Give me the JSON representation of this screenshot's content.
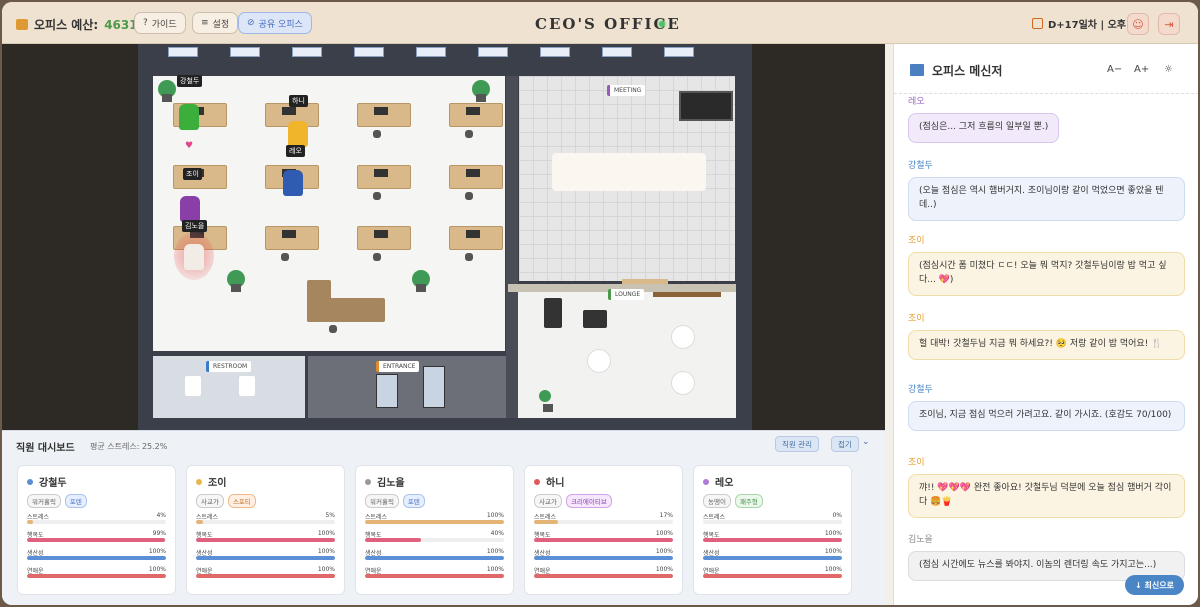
{
  "header": {
    "budget_label": "오피스 예산:",
    "budget_value": "4631원",
    "guide": "가이드",
    "settings": "설정",
    "share": "공유 오피스",
    "title": "CEO'S OFFICE",
    "day": "D+17일차 | 오후"
  },
  "game": {
    "rooms": {
      "meeting": "MEETING",
      "lounge": "LOUNGE",
      "restroom": "RESTROOM",
      "entrance": "ENTRANCE"
    },
    "characters": {
      "kang": "강철두",
      "hani": "하니",
      "leo": "레오",
      "joy": "조이",
      "kim": "김노을"
    }
  },
  "dashboard": {
    "title": "직원 대시보드",
    "avg": "평균 스트레스: 25.2%",
    "manage": "직원 관리",
    "collapse": "접기",
    "stat_labels": {
      "stress": "스트레스",
      "happy": "행복도",
      "prod": "생산성",
      "love": "연애운"
    },
    "employees": [
      {
        "name": "강철두",
        "color": "#5b8fd6",
        "tags": [
          "워커홀릭",
          "포텐"
        ],
        "stress": "4%",
        "happy": "99%",
        "prod": "100%",
        "love": "100%",
        "s": 4,
        "h": 99,
        "p": 100,
        "l": 100
      },
      {
        "name": "조이",
        "color": "#e6b84a",
        "tags": [
          "사교가",
          "스포티"
        ],
        "stress": "5%",
        "happy": "100%",
        "prod": "100%",
        "love": "100%",
        "s": 5,
        "h": 100,
        "p": 100,
        "l": 100
      },
      {
        "name": "김노을",
        "color": "#999999",
        "tags": [
          "워커홀릭",
          "포텐"
        ],
        "stress": "100%",
        "happy": "40%",
        "prod": "100%",
        "love": "100%",
        "s": 100,
        "h": 40,
        "p": 100,
        "l": 100
      },
      {
        "name": "하니",
        "color": "#e05a5a",
        "tags": [
          "사교가",
          "크리에이티브"
        ],
        "stress": "17%",
        "happy": "100%",
        "prod": "100%",
        "love": "100%",
        "s": 17,
        "h": 100,
        "p": 100,
        "l": 100
      },
      {
        "name": "레오",
        "color": "#b07ad6",
        "tags": [
          "농땡이",
          "패주형"
        ],
        "stress": "0%",
        "happy": "100%",
        "prod": "100%",
        "love": "100%",
        "s": 0,
        "h": 100,
        "p": 100,
        "l": 100
      }
    ]
  },
  "messenger": {
    "title": "오피스 메신저",
    "font_down": "A−",
    "font_up": "A+",
    "newest": "↓ 최신으로",
    "messages": [
      {
        "who": "레오",
        "text": "(점심은... 그저 흐름의 일부일 뿐.)"
      },
      {
        "who": "강철두",
        "text": "(오늘 점심은 역시 햄버거지. 조이님이랑 같이 먹었으면 좋았을 텐데..)"
      },
      {
        "who": "조이",
        "text": "(점심시간 폼 미쳤다 ㄷㄷ! 오늘 뭐 먹지? 갓철두님이랑 밥 먹고 싶다... 💖)"
      },
      {
        "who": "조이",
        "text": "헐 대박! 갓철두님 지금 뭐 하세요?! 🥺 저랑 같이 밥 먹어요! 🍴"
      },
      {
        "who": "강철두",
        "text": "조이님, 지금 점심 먹으러 가려고요. 같이 가시죠. (호감도 70/100)"
      },
      {
        "who": "조이",
        "text": "꺄!! 💖💖💖 완전 좋아요! 갓철두님 덕분에 오늘 점심 햄버거 각이다 🍔🍟"
      },
      {
        "who": "김노을",
        "text": "(점심 시간에도 뉴스를 봐야지. 이놈의 렌더링 속도 가지고는...)"
      }
    ]
  },
  "colors": {
    "kang": "#4a86c6",
    "joy": "#e6a030",
    "leo": "#9a6ac6",
    "kim": "#888888"
  }
}
